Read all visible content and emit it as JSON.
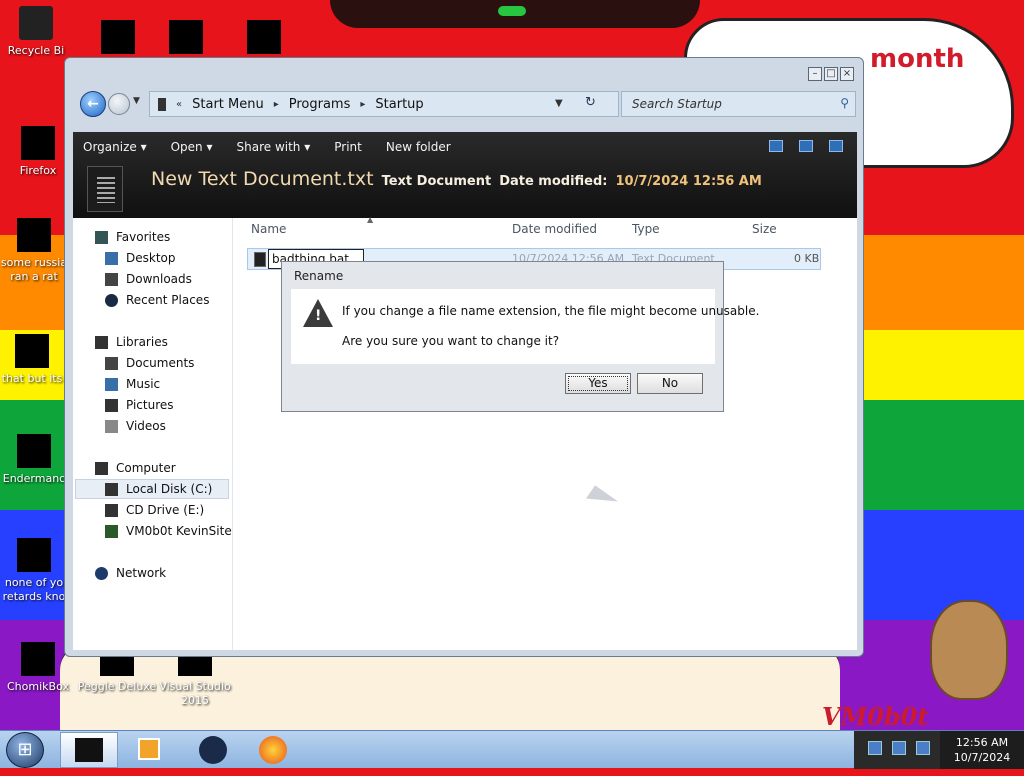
{
  "wallpaper": {
    "bubble_text": "month",
    "signature": "VM0b0t"
  },
  "desktop_icons": [
    {
      "label": "Recycle Bi"
    },
    {
      "label": "Firefox"
    },
    {
      "label": "some russia"
    },
    {
      "label": "ran a rat"
    },
    {
      "label": "that but its"
    },
    {
      "label": "Endermanc"
    },
    {
      "label": "none of yo"
    },
    {
      "label": "retards kno"
    },
    {
      "label": "ChomikBox"
    },
    {
      "label": "Peggle Deluxe"
    },
    {
      "label": "Visual Studio"
    },
    {
      "label": "2015"
    }
  ],
  "window": {
    "breadcrumb": [
      "Start Menu",
      "Programs",
      "Startup"
    ],
    "breadcrumb_prefix": "«",
    "search_placeholder": "Search Startup",
    "commands": [
      "Organize ▾",
      "Open ▾",
      "Share with ▾",
      "Print",
      "New folder"
    ],
    "details": {
      "file_name": "New Text Document.txt",
      "file_type": "Text Document",
      "date_label": "Date modified:",
      "date_value": "10/7/2024 12:56 AM"
    },
    "nav": {
      "favorites": "Favorites",
      "desktop": "Desktop",
      "downloads": "Downloads",
      "recent": "Recent Places",
      "libraries": "Libraries",
      "documents": "Documents",
      "music": "Music",
      "pictures": "Pictures",
      "videos": "Videos",
      "computer": "Computer",
      "local_disk": "Local Disk (C:)",
      "cd_drive": "CD Drive (E:)",
      "vm_site": "VM0b0t KevinSite",
      "network": "Network"
    },
    "columns": {
      "name": "Name",
      "date": "Date modified",
      "type": "Type",
      "size": "Size"
    },
    "file_row": {
      "rename_value": "badthing.bat",
      "date": "10/7/2024 12:56 AM",
      "type": "Text Document",
      "size": "0 KB"
    }
  },
  "dialog": {
    "title": "Rename",
    "message1": "If you change a file name extension, the file might become unusable.",
    "message2": "Are you sure you want to change it?",
    "yes": "Yes",
    "no": "No"
  },
  "taskbar": {
    "time": "12:56 AM",
    "date": "10/7/2024"
  }
}
